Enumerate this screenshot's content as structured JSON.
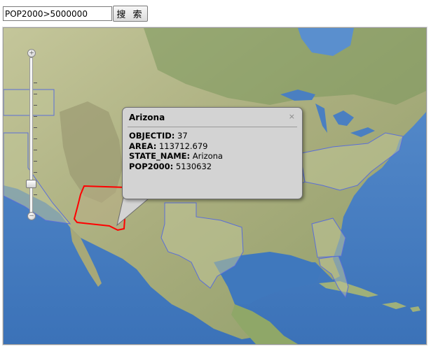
{
  "search": {
    "query_value": "POP2000>5000000",
    "button_label": "搜 索"
  },
  "popup": {
    "title": "Arizona",
    "close_glyph": "×",
    "fields": [
      {
        "key": "OBJECTID:",
        "value": " 37"
      },
      {
        "key": "AREA:",
        "value": " 113712.679"
      },
      {
        "key": "STATE_NAME:",
        "value": " Arizona"
      },
      {
        "key": "POP2000:",
        "value": " 5130632"
      }
    ]
  },
  "zoom": {
    "in_glyph": "+",
    "out_glyph": "−"
  },
  "colors": {
    "highlight": "#ff0000",
    "state_outline": "#5a6ed8",
    "ocean": "#4f83c6",
    "land": "#b3b487"
  }
}
